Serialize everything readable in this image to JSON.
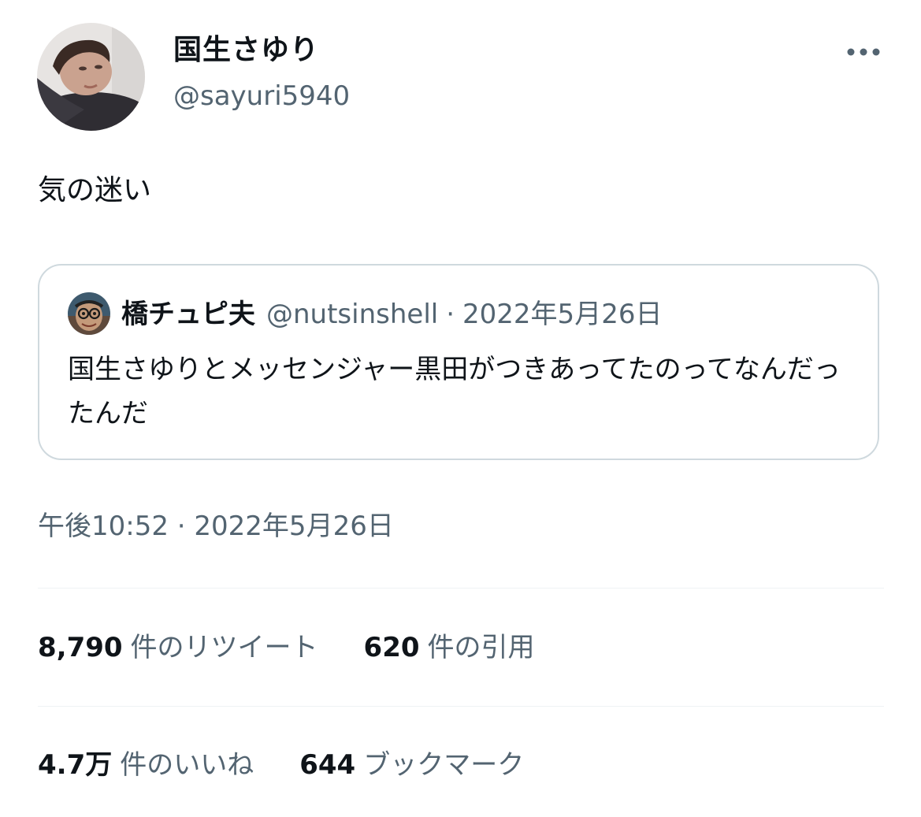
{
  "tweet": {
    "author": {
      "display_name": "国生さゆり",
      "handle": "@sayuri5940"
    },
    "text": "気の迷い",
    "timestamp": "午後10:52 · 2022年5月26日"
  },
  "quote": {
    "author": {
      "display_name": "橋チュピ夫",
      "handle": "@nutsinshell"
    },
    "separator": "·",
    "date": "2022年5月26日",
    "text": "国生さゆりとメッセンジャー黒田がつきあってたのってなんだったんだ"
  },
  "stats": {
    "retweets": {
      "count": "8,790",
      "label": "件のリツイート"
    },
    "quotes": {
      "count": "620",
      "label": "件の引用"
    },
    "likes": {
      "count": "4.7万",
      "label": "件のいいね"
    },
    "bookmarks": {
      "count": "644",
      "label": "ブックマーク"
    }
  },
  "icons": {
    "more": "more-horizontal-icon"
  },
  "colors": {
    "text_primary": "#0f1419",
    "text_secondary": "#536471",
    "border": "#cfd9de",
    "divider": "#eff3f4"
  }
}
